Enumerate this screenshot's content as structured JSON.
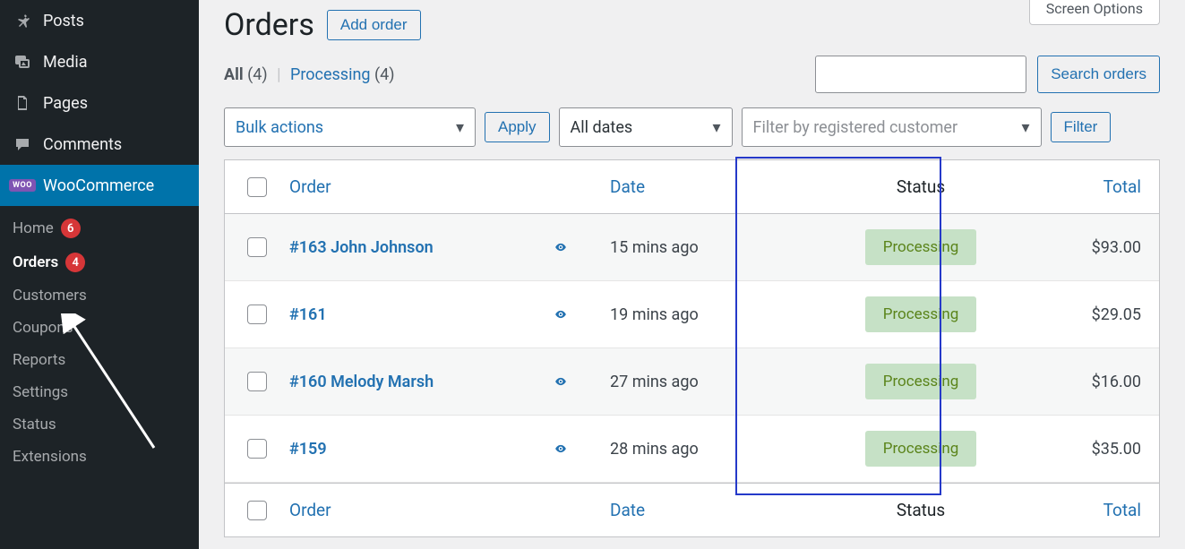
{
  "screen_options_label": "Screen Options",
  "sidebar": {
    "items": [
      {
        "label": "Posts"
      },
      {
        "label": "Media"
      },
      {
        "label": "Pages"
      },
      {
        "label": "Comments"
      },
      {
        "label": "WooCommerce"
      }
    ],
    "submenu": [
      {
        "label": "Home",
        "badge": "6"
      },
      {
        "label": "Orders",
        "badge": "4"
      },
      {
        "label": "Customers"
      },
      {
        "label": "Coupons"
      },
      {
        "label": "Reports"
      },
      {
        "label": "Settings"
      },
      {
        "label": "Status"
      },
      {
        "label": "Extensions"
      }
    ]
  },
  "header": {
    "title": "Orders",
    "add_label": "Add order"
  },
  "status_filters": {
    "all_label": "All",
    "all_count": "(4)",
    "processing_label": "Processing",
    "processing_count": "(4)"
  },
  "search": {
    "button": "Search orders"
  },
  "controls": {
    "bulk_label": "Bulk actions",
    "apply_label": "Apply",
    "dates_label": "All dates",
    "customer_placeholder": "Filter by registered customer",
    "filter_label": "Filter"
  },
  "columns": {
    "order": "Order",
    "date": "Date",
    "status": "Status",
    "total": "Total"
  },
  "orders": [
    {
      "label": "#163 John Johnson",
      "date": "15 mins ago",
      "status": "Processing",
      "total": "$93.00"
    },
    {
      "label": "#161",
      "date": "19 mins ago",
      "status": "Processing",
      "total": "$29.05"
    },
    {
      "label": "#160 Melody Marsh",
      "date": "27 mins ago",
      "status": "Processing",
      "total": "$16.00"
    },
    {
      "label": "#159",
      "date": "28 mins ago",
      "status": "Processing",
      "total": "$35.00"
    }
  ]
}
